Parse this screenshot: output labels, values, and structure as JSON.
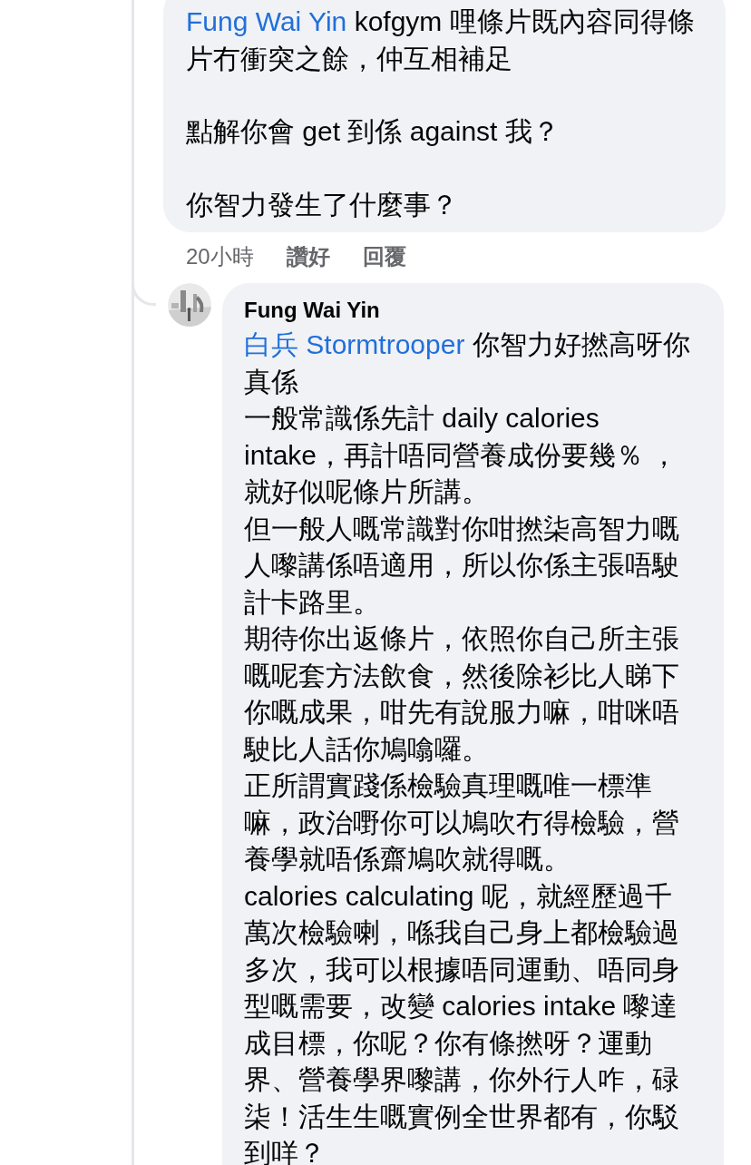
{
  "comments": [
    {
      "mention": "Fung Wai Yin",
      "text": " kofgym 哩條片既內容同得條片冇衝突之餘，仲互相補足",
      "blank_lines": true,
      "paragraphs": [
        "點解你會 get 到係 against 我？",
        "你智力發生了什麼事？"
      ],
      "time": "20小時",
      "actions": [
        "讚好",
        "回覆"
      ]
    },
    {
      "author": "Fung Wai Yin",
      "mention": "白兵 Stormtrooper",
      "text": " 你智力好撚高呀你真係",
      "blank_lines": false,
      "paragraphs": [
        "一般常識係先計 daily calories intake，再計唔同營養成份要幾％ ，就好似呢條片所講。",
        "但一般人嘅常識對你咁撚柒高智力嘅人嚟講係唔適用，所以你係主張唔駛計卡路里。",
        "期待你出返條片，依照你自己所主張嘅呢套方法飲食，然後除衫比人睇下你嘅成果，咁先有說服力嘛，咁咪唔駛比人話你鳩噏囉。",
        "正所謂實踐係檢驗真理嘅唯一標準嘛，政治嘢你可以鳩吹冇得檢驗，營養學就唔係齋鳩吹就得嘅。",
        "calories calculating 呢，就經歷過千萬次檢驗喇，喺我自己身上都檢驗過多次，我可以根據唔同運動、唔同身型嘅需要，改變 calories intake 嚟達成目標，你呢？你有條撚呀？運動界、營養學界嚟講，你外行人咋，碌柒！活生生嘅實例全世界都有，你駁到咩？"
      ]
    }
  ]
}
